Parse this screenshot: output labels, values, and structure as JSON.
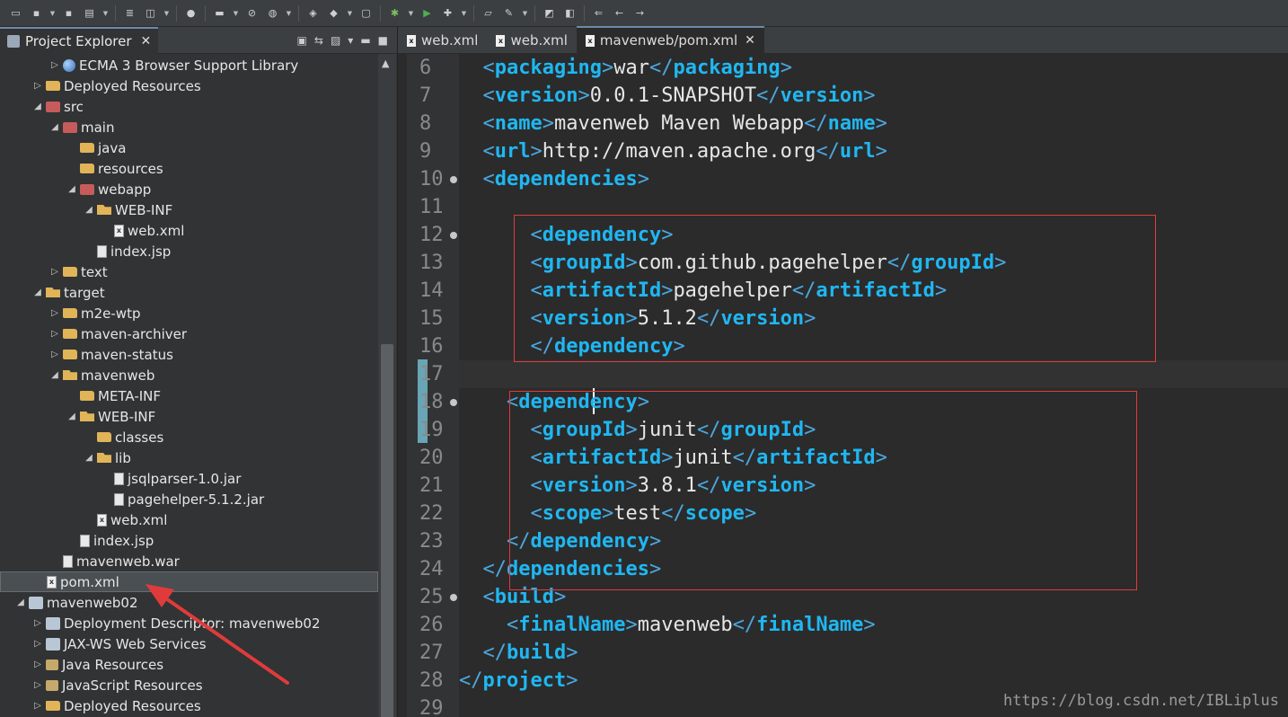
{
  "toolbar": {
    "icons": [
      "new-icon",
      "save-icon",
      "save-all-icon",
      "print-icon",
      "build-icon",
      "open-icon",
      "user-icon",
      "link-icon",
      "skip-icon",
      "globe-icon",
      "new-class-icon",
      "new-package-icon",
      "new-file-icon",
      "debug-icon",
      "run-icon",
      "external-tools-icon",
      "open-folder-icon",
      "brush-icon",
      "search-icon",
      "pin-icon",
      "back-icon",
      "prev-edit-icon",
      "forward-icon"
    ]
  },
  "project_explorer": {
    "title": "Project Explorer",
    "close": "✕",
    "items": [
      {
        "label": "ECMA 3 Browser Support Library",
        "indent": 3,
        "twisty": "▷",
        "icon": "globe"
      },
      {
        "label": "Deployed Resources",
        "indent": 2,
        "twisty": "▷",
        "icon": "folder"
      },
      {
        "label": "src",
        "indent": 2,
        "twisty": "◢",
        "icon": "pkg"
      },
      {
        "label": "main",
        "indent": 3,
        "twisty": "◢",
        "icon": "pkg"
      },
      {
        "label": "java",
        "indent": 4,
        "twisty": "",
        "icon": "folder"
      },
      {
        "label": "resources",
        "indent": 4,
        "twisty": "",
        "icon": "folder"
      },
      {
        "label": "webapp",
        "indent": 4,
        "twisty": "◢",
        "icon": "pkg"
      },
      {
        "label": "WEB-INF",
        "indent": 5,
        "twisty": "◢",
        "icon": "folder-open"
      },
      {
        "label": "web.xml",
        "indent": 6,
        "twisty": "",
        "icon": "xml"
      },
      {
        "label": "index.jsp",
        "indent": 5,
        "twisty": "",
        "icon": "file"
      },
      {
        "label": "text",
        "indent": 3,
        "twisty": "▷",
        "icon": "folder"
      },
      {
        "label": "target",
        "indent": 2,
        "twisty": "◢",
        "icon": "folder-open"
      },
      {
        "label": "m2e-wtp",
        "indent": 3,
        "twisty": "▷",
        "icon": "folder"
      },
      {
        "label": "maven-archiver",
        "indent": 3,
        "twisty": "▷",
        "icon": "folder"
      },
      {
        "label": "maven-status",
        "indent": 3,
        "twisty": "▷",
        "icon": "folder"
      },
      {
        "label": "mavenweb",
        "indent": 3,
        "twisty": "◢",
        "icon": "folder-open"
      },
      {
        "label": "META-INF",
        "indent": 4,
        "twisty": "",
        "icon": "folder"
      },
      {
        "label": "WEB-INF",
        "indent": 4,
        "twisty": "◢",
        "icon": "folder-open"
      },
      {
        "label": "classes",
        "indent": 5,
        "twisty": "",
        "icon": "folder"
      },
      {
        "label": "lib",
        "indent": 5,
        "twisty": "◢",
        "icon": "folder-open"
      },
      {
        "label": "jsqlparser-1.0.jar",
        "indent": 6,
        "twisty": "",
        "icon": "file"
      },
      {
        "label": "pagehelper-5.1.2.jar",
        "indent": 6,
        "twisty": "",
        "icon": "file"
      },
      {
        "label": "web.xml",
        "indent": 5,
        "twisty": "",
        "icon": "xml"
      },
      {
        "label": "index.jsp",
        "indent": 4,
        "twisty": "",
        "icon": "file"
      },
      {
        "label": "mavenweb.war",
        "indent": 3,
        "twisty": "",
        "icon": "file"
      },
      {
        "label": "pom.xml",
        "indent": 2,
        "twisty": "",
        "icon": "xml",
        "selected": true
      },
      {
        "label": "mavenweb02",
        "indent": 1,
        "twisty": "◢",
        "icon": "proj"
      },
      {
        "label": "Deployment Descriptor: mavenweb02",
        "indent": 2,
        "twisty": "▷",
        "icon": "proj"
      },
      {
        "label": "JAX-WS Web Services",
        "indent": 2,
        "twisty": "▷",
        "icon": "proj"
      },
      {
        "label": "Java Resources",
        "indent": 2,
        "twisty": "▷",
        "icon": "lib"
      },
      {
        "label": "JavaScript Resources",
        "indent": 2,
        "twisty": "▷",
        "icon": "lib"
      },
      {
        "label": "Deployed Resources",
        "indent": 2,
        "twisty": "▷",
        "icon": "folder"
      }
    ]
  },
  "editor": {
    "tabs": [
      {
        "label": "web.xml",
        "active": false
      },
      {
        "label": "web.xml",
        "active": false
      },
      {
        "label": "mavenweb/pom.xml",
        "active": true
      }
    ],
    "lines": [
      {
        "no": "6",
        "tokens": [
          [
            "p",
            "  "
          ],
          [
            "t",
            "<"
          ],
          [
            "n",
            "packaging"
          ],
          [
            "t",
            ">"
          ],
          [
            "x",
            "war"
          ],
          [
            "t",
            "</"
          ],
          [
            "n",
            "packaging"
          ],
          [
            "t",
            ">"
          ]
        ]
      },
      {
        "no": "7",
        "tokens": [
          [
            "p",
            "  "
          ],
          [
            "t",
            "<"
          ],
          [
            "n",
            "version"
          ],
          [
            "t",
            ">"
          ],
          [
            "x",
            "0.0.1-SNAPSHOT"
          ],
          [
            "t",
            "</"
          ],
          [
            "n",
            "version"
          ],
          [
            "t",
            ">"
          ]
        ]
      },
      {
        "no": "8",
        "tokens": [
          [
            "p",
            "  "
          ],
          [
            "t",
            "<"
          ],
          [
            "n",
            "name"
          ],
          [
            "t",
            ">"
          ],
          [
            "x",
            "mavenweb Maven Webapp"
          ],
          [
            "t",
            "</"
          ],
          [
            "n",
            "name"
          ],
          [
            "t",
            ">"
          ]
        ]
      },
      {
        "no": "9",
        "tokens": [
          [
            "p",
            "  "
          ],
          [
            "t",
            "<"
          ],
          [
            "n",
            "url"
          ],
          [
            "t",
            ">"
          ],
          [
            "x",
            "http://maven.apache.org"
          ],
          [
            "t",
            "</"
          ],
          [
            "n",
            "url"
          ],
          [
            "t",
            ">"
          ]
        ]
      },
      {
        "no": "10",
        "fold": true,
        "tokens": [
          [
            "p",
            "  "
          ],
          [
            "t",
            "<"
          ],
          [
            "n",
            "dependencies"
          ],
          [
            "t",
            ">"
          ]
        ]
      },
      {
        "no": "11",
        "tokens": []
      },
      {
        "no": "12",
        "fold": true,
        "tokens": [
          [
            "p",
            "      "
          ],
          [
            "t",
            "<"
          ],
          [
            "n",
            "dependency"
          ],
          [
            "t",
            ">"
          ]
        ]
      },
      {
        "no": "13",
        "tokens": [
          [
            "p",
            "      "
          ],
          [
            "t",
            "<"
          ],
          [
            "n",
            "groupId"
          ],
          [
            "t",
            ">"
          ],
          [
            "x",
            "com.github.pagehelper"
          ],
          [
            "t",
            "</"
          ],
          [
            "n",
            "groupId"
          ],
          [
            "t",
            ">"
          ]
        ]
      },
      {
        "no": "14",
        "tokens": [
          [
            "p",
            "      "
          ],
          [
            "t",
            "<"
          ],
          [
            "n",
            "artifactId"
          ],
          [
            "t",
            ">"
          ],
          [
            "x",
            "pagehelper"
          ],
          [
            "t",
            "</"
          ],
          [
            "n",
            "artifactId"
          ],
          [
            "t",
            ">"
          ]
        ]
      },
      {
        "no": "15",
        "tokens": [
          [
            "p",
            "      "
          ],
          [
            "t",
            "<"
          ],
          [
            "n",
            "version"
          ],
          [
            "t",
            ">"
          ],
          [
            "x",
            "5.1.2"
          ],
          [
            "t",
            "</"
          ],
          [
            "n",
            "version"
          ],
          [
            "t",
            ">"
          ]
        ]
      },
      {
        "no": "16",
        "tokens": [
          [
            "p",
            "      "
          ],
          [
            "t",
            "</"
          ],
          [
            "n",
            "dependency"
          ],
          [
            "t",
            ">"
          ]
        ]
      },
      {
        "no": "17",
        "tokens": [],
        "current": true
      },
      {
        "no": "18",
        "fold": true,
        "tokens": [
          [
            "p",
            "    "
          ],
          [
            "t",
            "<"
          ],
          [
            "n",
            "dependency"
          ],
          [
            "t",
            ">"
          ]
        ]
      },
      {
        "no": "19",
        "tokens": [
          [
            "p",
            "      "
          ],
          [
            "t",
            "<"
          ],
          [
            "n",
            "groupId"
          ],
          [
            "t",
            ">"
          ],
          [
            "x",
            "junit"
          ],
          [
            "t",
            "</"
          ],
          [
            "n",
            "groupId"
          ],
          [
            "t",
            ">"
          ]
        ]
      },
      {
        "no": "20",
        "tokens": [
          [
            "p",
            "      "
          ],
          [
            "t",
            "<"
          ],
          [
            "n",
            "artifactId"
          ],
          [
            "t",
            ">"
          ],
          [
            "x",
            "junit"
          ],
          [
            "t",
            "</"
          ],
          [
            "n",
            "artifactId"
          ],
          [
            "t",
            ">"
          ]
        ]
      },
      {
        "no": "21",
        "tokens": [
          [
            "p",
            "      "
          ],
          [
            "t",
            "<"
          ],
          [
            "n",
            "version"
          ],
          [
            "t",
            ">"
          ],
          [
            "x",
            "3.8.1"
          ],
          [
            "t",
            "</"
          ],
          [
            "n",
            "version"
          ],
          [
            "t",
            ">"
          ]
        ]
      },
      {
        "no": "22",
        "tokens": [
          [
            "p",
            "      "
          ],
          [
            "t",
            "<"
          ],
          [
            "n",
            "scope"
          ],
          [
            "t",
            ">"
          ],
          [
            "x",
            "test"
          ],
          [
            "t",
            "</"
          ],
          [
            "n",
            "scope"
          ],
          [
            "t",
            ">"
          ]
        ]
      },
      {
        "no": "23",
        "tokens": [
          [
            "p",
            "    "
          ],
          [
            "t",
            "</"
          ],
          [
            "n",
            "dependency"
          ],
          [
            "t",
            ">"
          ]
        ]
      },
      {
        "no": "24",
        "tokens": [
          [
            "p",
            "  "
          ],
          [
            "t",
            "</"
          ],
          [
            "n",
            "dependencies"
          ],
          [
            "t",
            ">"
          ]
        ]
      },
      {
        "no": "25",
        "fold": true,
        "tokens": [
          [
            "p",
            "  "
          ],
          [
            "t",
            "<"
          ],
          [
            "n",
            "build"
          ],
          [
            "t",
            ">"
          ]
        ]
      },
      {
        "no": "26",
        "tokens": [
          [
            "p",
            "    "
          ],
          [
            "t",
            "<"
          ],
          [
            "n",
            "finalName"
          ],
          [
            "t",
            ">"
          ],
          [
            "x",
            "mavenweb"
          ],
          [
            "t",
            "</"
          ],
          [
            "n",
            "finalName"
          ],
          [
            "t",
            ">"
          ]
        ]
      },
      {
        "no": "27",
        "tokens": [
          [
            "p",
            "  "
          ],
          [
            "t",
            "</"
          ],
          [
            "n",
            "build"
          ],
          [
            "t",
            ">"
          ]
        ]
      },
      {
        "no": "28",
        "tokens": [
          [
            "t",
            "</"
          ],
          [
            "n",
            "project"
          ],
          [
            "t",
            ">"
          ]
        ]
      },
      {
        "no": "29",
        "tokens": []
      }
    ]
  },
  "watermark": "https://blog.csdn.net/IBLiplus",
  "colors": {
    "annotation_red": "#e03b3b",
    "tag_blue": "#1fb7f2"
  }
}
